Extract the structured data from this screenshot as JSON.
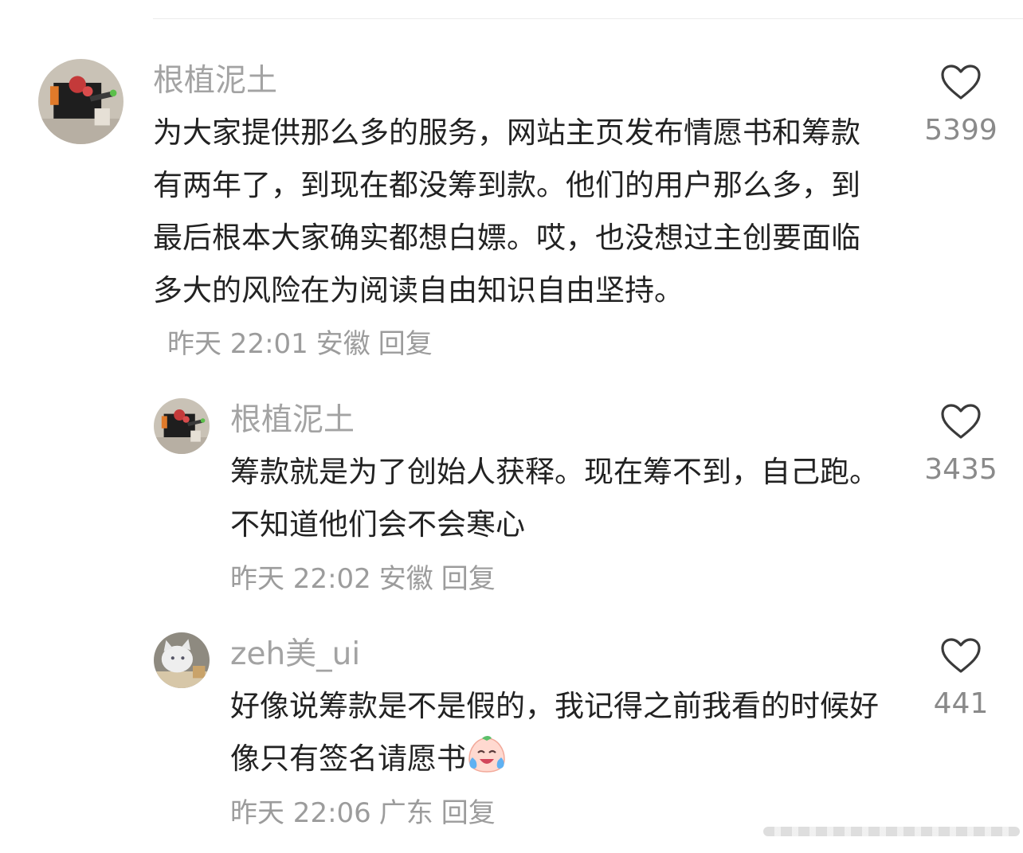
{
  "comments": [
    {
      "username": "根植泥土",
      "text": "为大家提供那么多的服务，网站主页发布情愿书和筹款有两年了，到现在都没筹到款。他们的用户那么多，到最后根本大家确实都想白嫖。哎，也没想过主创要面临多大的风险在为阅读自由知识自由坚持。",
      "time": "昨天 22:01",
      "location": "安徽",
      "reply_label": "回复",
      "likes": "5399",
      "avatar_icon": "avatar-photo-icon"
    },
    {
      "username": "根植泥土",
      "text": "筹款就是为了创始人获释。现在筹不到，自己跑。不知道他们会不会寒心",
      "time": "昨天 22:02",
      "location": "安徽",
      "reply_label": "回复",
      "likes": "3435",
      "avatar_icon": "avatar-photo-icon"
    },
    {
      "username": "zeh美_ui",
      "text": "好像说筹款是不是假的，我记得之前我看的时候好像只有签名请愿书",
      "time": "昨天 22:06",
      "location": "广东",
      "reply_label": "回复",
      "likes": "441",
      "avatar_icon": "cat-avatar-icon",
      "emoji_icon": "crying-laughing-emoji-icon"
    }
  ],
  "colors": {
    "username": "#a3a3a3",
    "text": "#222222",
    "meta": "#9c9c9c",
    "like_count": "#8a8a8a"
  }
}
